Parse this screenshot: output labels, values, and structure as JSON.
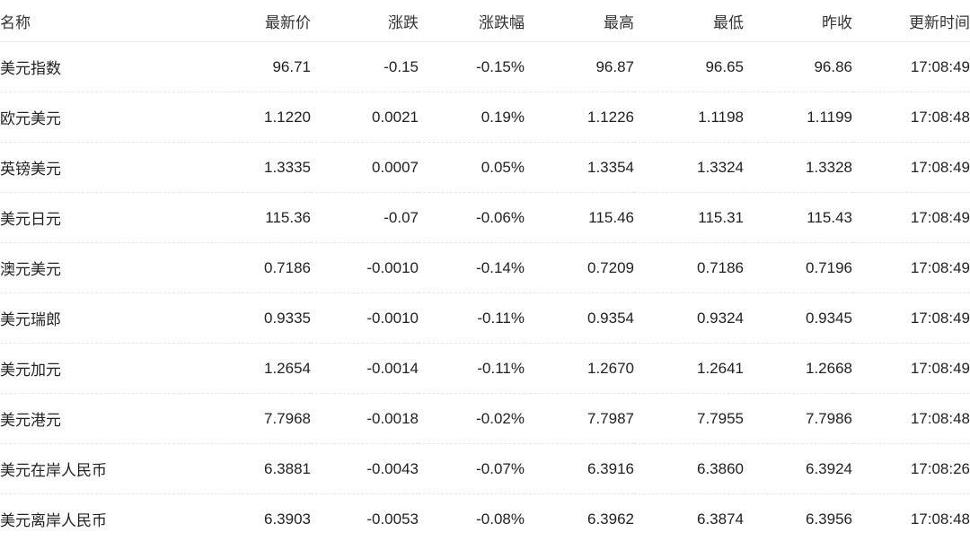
{
  "headers": {
    "name": "名称",
    "last": "最新价",
    "change": "涨跌",
    "change_pct": "涨跌幅",
    "high": "最高",
    "low": "最低",
    "prev_close": "昨收",
    "update_time": "更新时间"
  },
  "colors": {
    "up": "#e0525a",
    "down": "#3fae7a",
    "text": "#222222"
  },
  "rows": [
    {
      "name": "美元指数",
      "last": "96.71",
      "change": "-0.15",
      "change_pct": "-0.15%",
      "high": "96.87",
      "low": "96.65",
      "prev_close": "96.86",
      "time": "17:08:49",
      "direction": "down"
    },
    {
      "name": "欧元美元",
      "last": "1.1220",
      "change": "0.0021",
      "change_pct": "0.19%",
      "high": "1.1226",
      "low": "1.1198",
      "prev_close": "1.1199",
      "time": "17:08:48",
      "direction": "up"
    },
    {
      "name": "英镑美元",
      "last": "1.3335",
      "change": "0.0007",
      "change_pct": "0.05%",
      "high": "1.3354",
      "low": "1.3324",
      "prev_close": "1.3328",
      "time": "17:08:49",
      "direction": "up"
    },
    {
      "name": "美元日元",
      "last": "115.36",
      "change": "-0.07",
      "change_pct": "-0.06%",
      "high": "115.46",
      "low": "115.31",
      "prev_close": "115.43",
      "time": "17:08:49",
      "direction": "down"
    },
    {
      "name": "澳元美元",
      "last": "0.7186",
      "change": "-0.0010",
      "change_pct": "-0.14%",
      "high": "0.7209",
      "low": "0.7186",
      "prev_close": "0.7196",
      "time": "17:08:49",
      "direction": "down"
    },
    {
      "name": "美元瑞郎",
      "last": "0.9335",
      "change": "-0.0010",
      "change_pct": "-0.11%",
      "high": "0.9354",
      "low": "0.9324",
      "prev_close": "0.9345",
      "time": "17:08:49",
      "direction": "down"
    },
    {
      "name": "美元加元",
      "last": "1.2654",
      "change": "-0.0014",
      "change_pct": "-0.11%",
      "high": "1.2670",
      "low": "1.2641",
      "prev_close": "1.2668",
      "time": "17:08:49",
      "direction": "down"
    },
    {
      "name": "美元港元",
      "last": "7.7968",
      "change": "-0.0018",
      "change_pct": "-0.02%",
      "high": "7.7987",
      "low": "7.7955",
      "prev_close": "7.7986",
      "time": "17:08:48",
      "direction": "down"
    },
    {
      "name": "美元在岸人民币",
      "last": "6.3881",
      "change": "-0.0043",
      "change_pct": "-0.07%",
      "high": "6.3916",
      "low": "6.3860",
      "prev_close": "6.3924",
      "time": "17:08:26",
      "direction": "down"
    },
    {
      "name": "美元离岸人民币",
      "last": "6.3903",
      "change": "-0.0053",
      "change_pct": "-0.08%",
      "high": "6.3962",
      "low": "6.3874",
      "prev_close": "6.3956",
      "time": "17:08:48",
      "direction": "down"
    }
  ]
}
